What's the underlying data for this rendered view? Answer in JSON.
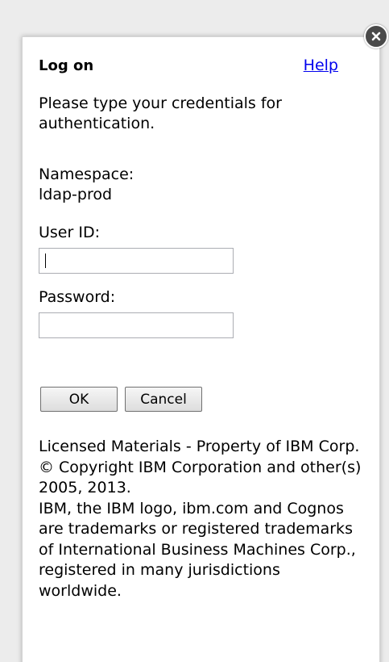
{
  "dialog": {
    "title": "Log on",
    "help_label": "Help",
    "instructions": "Please type your credentials for authentication.",
    "namespace_label": "Namespace:",
    "namespace_value": "ldap-prod",
    "userid_label": "User ID:",
    "userid_value": "",
    "password_label": "Password:",
    "password_value": "",
    "ok_label": "OK",
    "cancel_label": "Cancel",
    "footer": {
      "line1": "Licensed Materials - Property of IBM Corp.",
      "line2": "© Copyright IBM Corporation and other(s) 2005, 2013.",
      "line3": "IBM, the IBM logo, ibm.com and Cognos are trademarks or registered trademarks of International Business Machines Corp., registered in many jurisdictions worldwide."
    },
    "close_icon": "close-x-circle-icon"
  },
  "colors": {
    "link": "#0000ee",
    "close_button": "#4a4a4a",
    "background": "#ececec"
  }
}
